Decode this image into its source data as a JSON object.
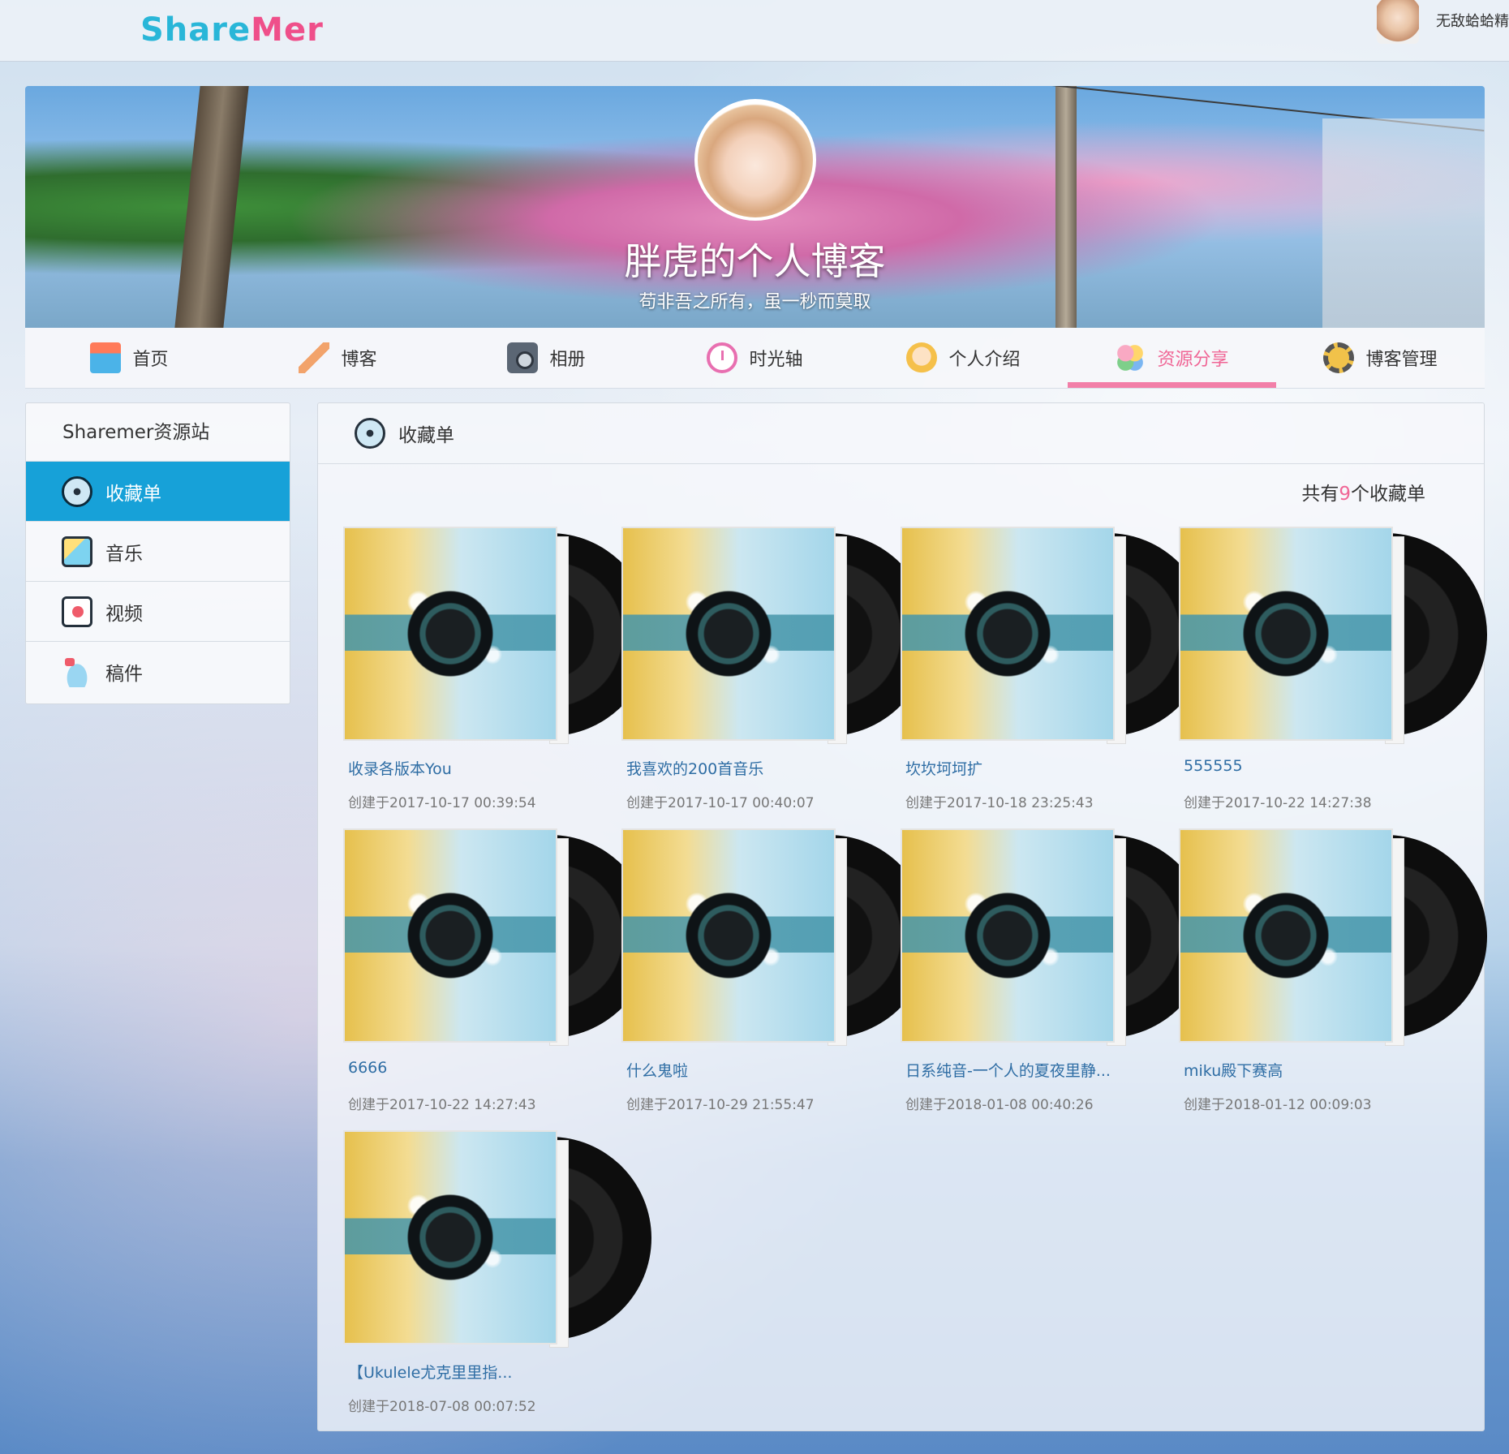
{
  "header": {
    "logo_part1": "Share",
    "logo_part2": "Mer",
    "user_name": "无敌蛤蛤精"
  },
  "banner": {
    "title": "胖虎的个人博客",
    "subtitle": "苟非吾之所有，虽一秒而莫取"
  },
  "nav": {
    "items": [
      {
        "label": "首页",
        "icon": "home-icon"
      },
      {
        "label": "博客",
        "icon": "feather-icon"
      },
      {
        "label": "相册",
        "icon": "camera-icon"
      },
      {
        "label": "时光轴",
        "icon": "clock-icon"
      },
      {
        "label": "个人介绍",
        "icon": "person-icon"
      },
      {
        "label": "资源分享",
        "icon": "share-icon",
        "active": true
      },
      {
        "label": "博客管理",
        "icon": "gear-icon"
      }
    ]
  },
  "sidebar": {
    "title": "Sharemer资源站",
    "items": [
      {
        "label": "收藏单",
        "icon": "disc-icon",
        "active": true
      },
      {
        "label": "音乐",
        "icon": "music-icon"
      },
      {
        "label": "视频",
        "icon": "video-icon"
      },
      {
        "label": "稿件",
        "icon": "cloud-icon"
      }
    ]
  },
  "main": {
    "title": "收藏单",
    "count_prefix": "共有",
    "count_num": "9",
    "count_suffix": "个收藏单",
    "playlists": [
      {
        "title": "收录各版本You",
        "date": "创建于2017-10-17 00:39:54"
      },
      {
        "title": "我喜欢的200首音乐",
        "date": "创建于2017-10-17 00:40:07"
      },
      {
        "title": "坎坎坷坷扩",
        "date": "创建于2017-10-18 23:25:43"
      },
      {
        "title": "555555",
        "date": "创建于2017-10-22 14:27:38"
      },
      {
        "title": "6666",
        "date": "创建于2017-10-22 14:27:43"
      },
      {
        "title": "什么鬼啦",
        "date": "创建于2017-10-29 21:55:47"
      },
      {
        "title": "日系纯音-一个人的夏夜里静...",
        "date": "创建于2018-01-08 00:40:26"
      },
      {
        "title": "miku殿下赛高",
        "date": "创建于2018-01-12 00:09:03"
      },
      {
        "title": "【Ukulele尤克里里指...",
        "date": "创建于2018-07-08 00:07:52"
      }
    ]
  },
  "colors": {
    "accent_pink": "#f06595",
    "sidebar_active": "#17a1d8",
    "link_blue": "#2e6da4"
  }
}
